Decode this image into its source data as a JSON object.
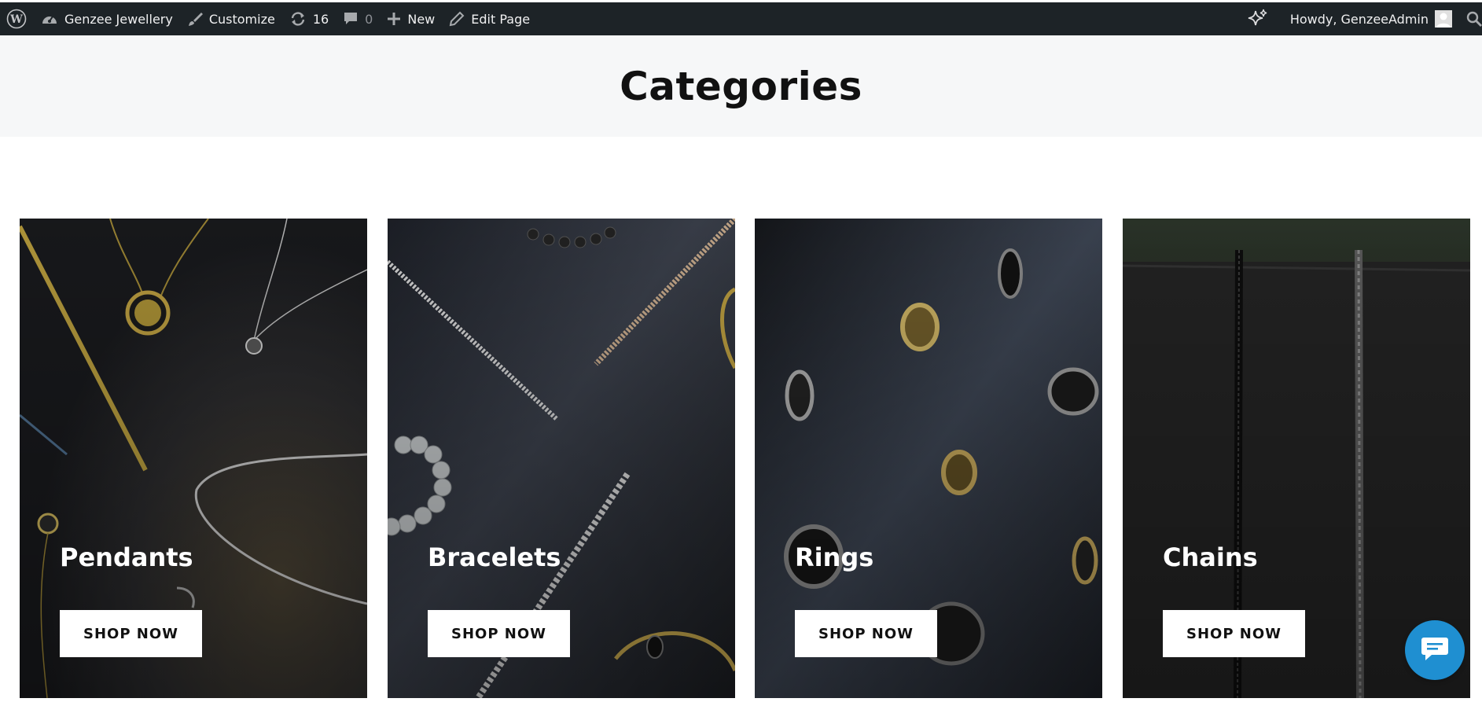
{
  "adminbar": {
    "site_name": "Genzee Jewellery",
    "customize": "Customize",
    "updates_count": "16",
    "comments_count": "0",
    "new_label": "New",
    "edit_page": "Edit Page",
    "howdy": "Howdy, GenzeeAdmin"
  },
  "page": {
    "title": "Categories"
  },
  "categories": [
    {
      "title": "Pendants",
      "button": "SHOP NOW"
    },
    {
      "title": "Bracelets",
      "button": "SHOP NOW"
    },
    {
      "title": "Rings",
      "button": "SHOP NOW"
    },
    {
      "title": "Chains",
      "button": "SHOP NOW"
    }
  ],
  "icons": {
    "wordpress": "wordpress-logo-icon",
    "dashboard": "dashboard-gauge-icon",
    "customize": "paintbrush-icon",
    "updates": "refresh-icon",
    "comments": "comment-bubble-icon",
    "new": "plus-icon",
    "edit": "pencil-icon",
    "ai": "sparkle-icon",
    "search": "search-icon",
    "chat": "chat-message-icon"
  },
  "colors": {
    "adminbar_bg": "#1d2327",
    "header_bg": "#f6f7f8",
    "chat_accent": "#1f8fd1"
  }
}
